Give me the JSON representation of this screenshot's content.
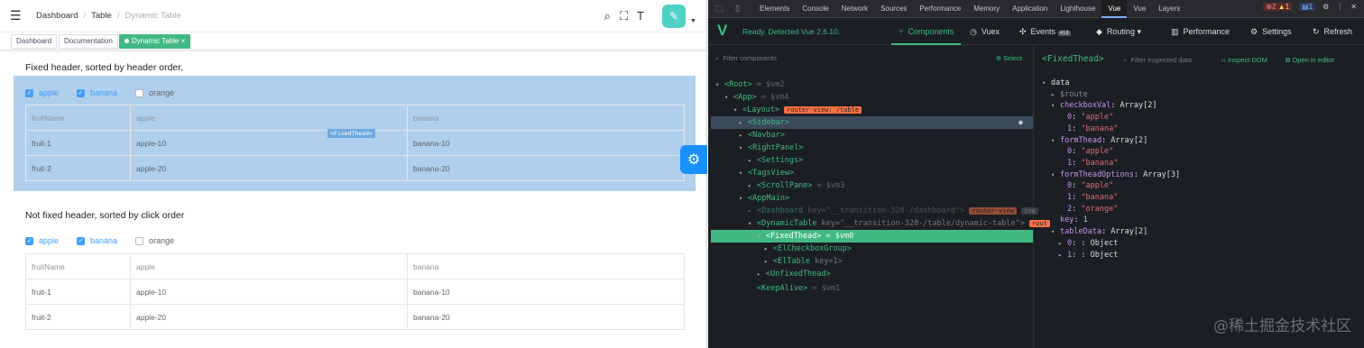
{
  "breadcrumb": {
    "items": [
      "Dashboard",
      "Table",
      "Dynamic Table"
    ],
    "sep": "/"
  },
  "tags": [
    {
      "label": "Dashboard"
    },
    {
      "label": "Documentation"
    },
    {
      "label": "Dynamic Table",
      "close": "×"
    }
  ],
  "section1": {
    "title": "Fixed header, sorted by header order,"
  },
  "section2": {
    "title": "Not fixed header, sorted by click order"
  },
  "checkboxes": [
    {
      "label": "apple",
      "checked": true
    },
    {
      "label": "banana",
      "checked": true
    },
    {
      "label": "orange",
      "checked": false
    }
  ],
  "table": {
    "headers": [
      "fruitName",
      "apple",
      "banana"
    ],
    "rows": [
      [
        "fruit-1",
        "apple-10",
        "banana-10"
      ],
      [
        "fruit-2",
        "apple-20",
        "banana-20"
      ]
    ]
  },
  "overlay_badge": "<FixedThead>",
  "devtools": {
    "tabs": [
      "Elements",
      "Console",
      "Network",
      "Sources",
      "Performance",
      "Memory",
      "Application",
      "Lighthouse",
      "Vue",
      "Vue",
      "Layers"
    ],
    "active_tab": "Vue",
    "errors": "2",
    "warnings": "1",
    "infos": "1",
    "ready_text": "Ready. Detected Vue 2.6.10.",
    "vue_tabs": [
      "Components",
      "Vuex",
      "Events",
      "Routing",
      "Performance",
      "Settings",
      "Refresh"
    ],
    "events_count": "418",
    "filter_placeholder": "Filter components",
    "select_label": "Select",
    "inspected": "<FixedThead>",
    "inspect_filter": "Filter inspected data",
    "inspect_dom": "Inspect DOM",
    "open_editor": "Open in editor"
  },
  "tree": [
    {
      "t": "<Root>",
      "s": " = $vm2"
    },
    {
      "t": "<App>",
      "s": " = $vm4"
    },
    {
      "t": "<Layout>",
      "tag": "router-view: /table"
    },
    {
      "t": "<Sidebar>"
    },
    {
      "t": "<Navbar>"
    },
    {
      "t": "<RightPanel>"
    },
    {
      "t": "<Settings>"
    },
    {
      "t": "<TagsView>"
    },
    {
      "t": "<ScrollPane>",
      "s": " = $vm3"
    },
    {
      "t": "<AppMain>"
    },
    {
      "t": "<Dashboard",
      "k": " key=\"__transition-328-/dashboard\">",
      "tag": "router-view",
      "tag2": "ina"
    },
    {
      "t": "<DynamicTable",
      "k": " key=\"__transition-328-/table/dynamic-table\">",
      "tag": "rout"
    },
    {
      "t": "<FixedThead>",
      "s": " = $vm0"
    },
    {
      "t": "<ElCheckboxGroup>"
    },
    {
      "t": "<ElTable",
      "k": " key=1>"
    },
    {
      "t": "<UnfixedThead>"
    },
    {
      "t": "<KeepAlive>",
      "s": " = $vm1"
    }
  ],
  "inspector": [
    {
      "k": "data"
    },
    {
      "k": "$route"
    },
    {
      "k": "checkboxVal",
      "v": ": Array[2]"
    },
    {
      "i": "0",
      "s": "\"apple\""
    },
    {
      "i": "1",
      "s": "\"banana\""
    },
    {
      "k": "formThead",
      "v": ": Array[2]"
    },
    {
      "i": "0",
      "s": "\"apple\""
    },
    {
      "i": "1",
      "s": "\"banana\""
    },
    {
      "k": "formTheadOptions",
      "v": ": Array[3]"
    },
    {
      "i": "0",
      "s": "\"apple\""
    },
    {
      "i": "1",
      "s": "\"banana\""
    },
    {
      "i": "2",
      "s": "\"orange\""
    },
    {
      "k": "key",
      "n": "1"
    },
    {
      "k": "tableData",
      "v": ": Array[2]"
    },
    {
      "i": "0",
      "v": ": Object"
    },
    {
      "i": "1",
      "v": ": Object"
    }
  ],
  "watermark": "@稀土掘金技术社区"
}
